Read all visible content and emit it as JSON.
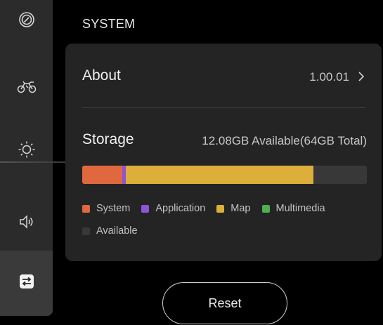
{
  "sidebar": {
    "items": [
      {
        "icon": "speedometer-icon"
      },
      {
        "icon": "motorcycle-icon"
      },
      {
        "icon": "brightness-icon"
      },
      {
        "icon": "volume-icon"
      },
      {
        "icon": "system-settings-icon",
        "active": true
      }
    ]
  },
  "page": {
    "title": "SYSTEM"
  },
  "about": {
    "label": "About",
    "version": "1.00.01"
  },
  "storage": {
    "label": "Storage",
    "summary": "12.08GB Available(64GB Total)",
    "segments": [
      {
        "name": "System",
        "fraction": 0.14,
        "color": "#e0683e"
      },
      {
        "name": "Application",
        "fraction": 0.012,
        "color": "#8f54d6"
      },
      {
        "name": "Map",
        "fraction": 0.66,
        "color": "#dcae3a"
      },
      {
        "name": "Multimedia",
        "fraction": 0.0,
        "color": "#4caf50"
      },
      {
        "name": "Available",
        "fraction": 0.188,
        "color": "#383838"
      }
    ],
    "legend": [
      {
        "label": "System",
        "color": "#e0683e"
      },
      {
        "label": "Application",
        "color": "#8f54d6"
      },
      {
        "label": "Map",
        "color": "#dcae3a"
      },
      {
        "label": "Multimedia",
        "color": "#4caf50"
      },
      {
        "label": "Available",
        "color": "#383838"
      }
    ]
  },
  "actions": {
    "reset_label": "Reset"
  }
}
